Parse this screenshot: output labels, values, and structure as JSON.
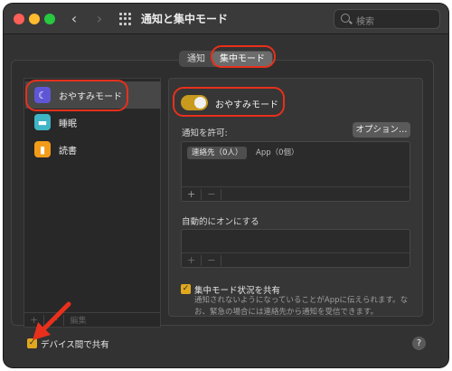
{
  "window": {
    "title": "通知と集中モード"
  },
  "search": {
    "placeholder": "検索"
  },
  "tabs": [
    {
      "label": "通知",
      "active": false
    },
    {
      "label": "集中モード",
      "active": true
    }
  ],
  "sidebar": {
    "items": [
      {
        "label": "おやすみモード",
        "icon": "moon-icon",
        "color": "#5f56d6",
        "selected": true
      },
      {
        "label": "睡眠",
        "icon": "bed-icon",
        "color": "#3eb5c5",
        "selected": false
      },
      {
        "label": "読書",
        "icon": "book-icon",
        "color": "#f39c1a",
        "selected": false
      }
    ],
    "footer": {
      "add": "+",
      "remove": "−",
      "edit": "編集"
    }
  },
  "detail": {
    "focus_toggle_label": "おやすみモード",
    "focus_toggle_on": true,
    "allow_label": "通知を許可:",
    "options_button": "オプション…",
    "allow_chips": [
      "連絡先（0人）",
      "App（0個）"
    ],
    "list_add": "+",
    "list_remove": "−",
    "auto_label": "自動的にオンにする",
    "share_checked": true,
    "share_label": "集中モード状況を共有",
    "share_desc": "通知されないようになっていることがAppに伝えられます。なお、緊急の場合には連絡先から通知を受信できます。"
  },
  "footer": {
    "device_share_checked": true,
    "device_share_label": "デバイス間で共有",
    "help": "?"
  },
  "colors": {
    "accent": "#e0a81f",
    "annotation": "#e8301c"
  }
}
